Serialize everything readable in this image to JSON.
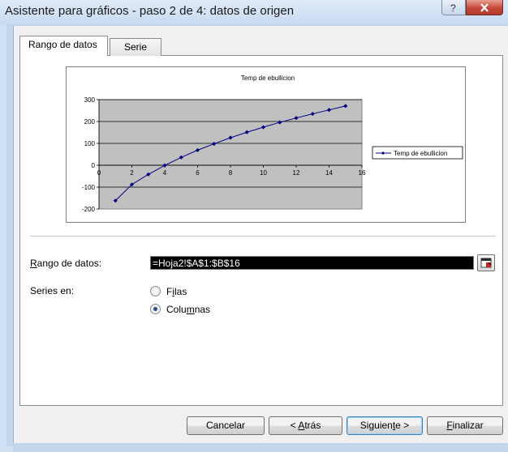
{
  "window": {
    "title": "Asistente para gráficos - paso 2 de 4: datos de origen"
  },
  "tabs": [
    {
      "label": "Rango de datos",
      "active": true
    },
    {
      "label": "Serie",
      "active": false
    }
  ],
  "chart_data": {
    "type": "line",
    "title": "Temp de ebullicion",
    "x": [
      1,
      2,
      3,
      4,
      5,
      6,
      7,
      8,
      9,
      10,
      11,
      12,
      13,
      14,
      15
    ],
    "series": [
      {
        "name": "Temp de ebullicion",
        "values": [
          -162,
          -88,
          -42,
          -0.5,
          36,
          69,
          98,
          126,
          151,
          174,
          196,
          216,
          235,
          253,
          271
        ]
      }
    ],
    "xlim": [
      0,
      16
    ],
    "ylim": [
      -200,
      300
    ],
    "xticks": [
      0,
      2,
      4,
      6,
      8,
      10,
      12,
      14,
      16
    ],
    "yticks": [
      -200,
      -100,
      0,
      100,
      200,
      300
    ],
    "grid": true,
    "legend": "right",
    "colors": {
      "plot_bg": "#c0c0c0",
      "series": "#000080"
    },
    "legend_label": "Temp de ebullicion"
  },
  "source": {
    "range_label_first": "R",
    "range_label_rest": "ango de datos:",
    "range_value": "=Hoja2!$A$1:$B$16",
    "series_in_label": "Series en:",
    "options": [
      {
        "pre": "F",
        "u": "i",
        "post": "las",
        "selected": false
      },
      {
        "pre": "Colu",
        "u": "m",
        "post": "nas",
        "selected": true
      }
    ]
  },
  "buttons": {
    "cancel": "Cancelar",
    "back_pre": "< ",
    "back_u": "A",
    "back_post": "trás",
    "next_pre": "Siguien",
    "next_u": "t",
    "next_post": "e >",
    "finish_u": "F",
    "finish_post": "inalizar"
  }
}
